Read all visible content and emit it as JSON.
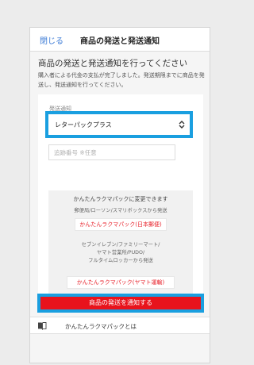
{
  "header": {
    "close_label": "閉じる",
    "title": "商品の発送と発送通知"
  },
  "section": {
    "heading": "商品の発送と発送通知を行ってください",
    "description": "購入者による代金の支払が完了しました。発送期限までに商品を発送し、発送通知を行ってください。"
  },
  "form": {
    "shipping_label": "発送通知",
    "shipping_method": "レターパックプラス",
    "tracking_placeholder": "追跡番号 ※任意",
    "tracking_value": ""
  },
  "rakuraku": {
    "title": "かんたんラクマパックに変更できます",
    "japanpost_caption": "郵便局/ローソン/スマリボックスから発送",
    "japanpost_button": "かんたんラクマパック(日本郵便)",
    "yamato_caption_lines": [
      "セブンイレブン/ファミリーマート/",
      "ヤマト営業所/PUDO/",
      "フルタイムロッカーから発送"
    ],
    "yamato_button": "かんたんラクマパック(ヤマト運輸)"
  },
  "actions": {
    "notify_button": "商品の発送を通知する"
  },
  "footer": {
    "about_label": "かんたんラクマパックとは"
  },
  "icons": {
    "select_caret": "updown-caret-icon",
    "about": "book-icon"
  },
  "colors": {
    "accent_blue": "#3c7bd6",
    "highlight_blue": "#1a9fe0",
    "primary_red": "#e8131c",
    "link_red": "#e8222b"
  }
}
